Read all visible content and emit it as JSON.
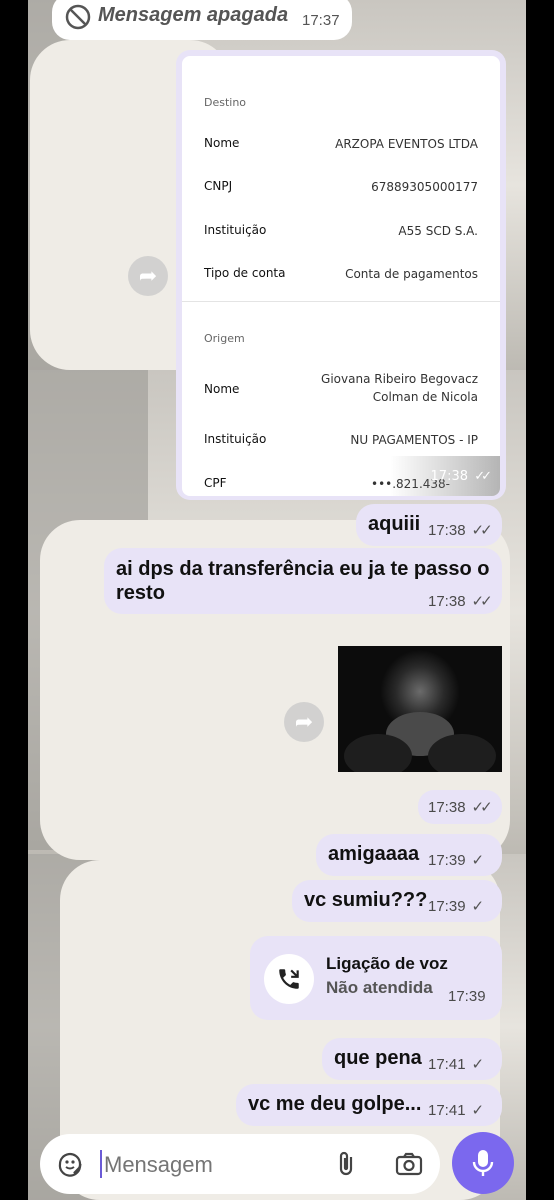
{
  "deleted_message": {
    "text": "Mensagem apagada",
    "time": "17:37"
  },
  "receipt": {
    "destino_title": "Destino",
    "destino_rows": [
      {
        "label": "Nome",
        "value": "ARZOPA EVENTOS LTDA"
      },
      {
        "label": "CNPJ",
        "value": "67889305000177"
      },
      {
        "label": "Instituição",
        "value": "A55 SCD S.A."
      },
      {
        "label": "Tipo de conta",
        "value": "Conta de pagamentos"
      }
    ],
    "origem_title": "Origem",
    "origem_nome_label": "Nome",
    "origem_nome_value_1": "Giovana Ribeiro Begovacz",
    "origem_nome_value_2": "Colman de Nicola",
    "origem_inst_label": "Instituição",
    "origem_inst_value": "NU PAGAMENTOS - IP",
    "cpf_label": "CPF",
    "cpf_value": "•••.821.438-",
    "time": "17:38"
  },
  "messages": [
    {
      "text": "aquiii",
      "time": "17:38",
      "status": "read"
    },
    {
      "text_line1": "ai dps da transferência eu ja te passo o",
      "text_line2": "resto",
      "time": "17:38",
      "status": "read"
    },
    {
      "image": "praying-man-photo",
      "time": "17:38",
      "status": "read"
    },
    {
      "text": "amigaaaa",
      "time": "17:39",
      "status": "sent"
    },
    {
      "text": "vc sumiu???",
      "time": "17:39",
      "status": "sent"
    },
    {
      "call_title": "Ligação de voz",
      "call_status": "Não atendida",
      "time": "17:39",
      "icon": "missed-call-icon"
    },
    {
      "text": "que pena",
      "time": "17:41",
      "status": "sent"
    },
    {
      "text": "vc me deu golpe...",
      "time": "17:41",
      "status": "sent"
    }
  ],
  "input": {
    "placeholder": "Mensagem"
  },
  "colors": {
    "outgoing_bubble": "#e8e3f7",
    "mic_button": "#7b68ee",
    "ticks": "#555555"
  }
}
